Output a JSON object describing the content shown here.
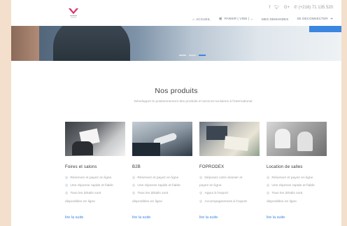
{
  "header": {
    "phone": "(+216) 71 135 520",
    "social": [
      "f",
      "twitter",
      "G+"
    ],
    "nav": [
      {
        "label": "ACCUEIL",
        "icon": "home-icon"
      },
      {
        "label": "PANIER ( VIDE )",
        "icon": "cart-icon"
      },
      {
        "label": "MES DEMANDES",
        "icon": ""
      },
      {
        "label": "SE DECONNECTER ",
        "icon": ""
      }
    ]
  },
  "section": {
    "title": "Nos produits",
    "subtitle": "Développer le positionnement des produits et services tunisiens à l'international"
  },
  "cards": [
    {
      "title": "Foires et salons",
      "items": [
        "Réservez et payez en ligne",
        "Une réponse rapide et fiable",
        "Tous les détails sont",
        "disponibles en ligne"
      ],
      "more": "lire la suite"
    },
    {
      "title": "B2B",
      "items": [
        "Réservez et payez en ligne",
        "Une réponse rapide et fiable",
        "Tous les détails sont",
        "disponibles en ligne"
      ],
      "more": "lire la suite"
    },
    {
      "title": "FOPRODEX",
      "items": [
        "Déposez votre dossier et",
        "payez en ligne",
        "Appui à l'export",
        "Accompagnement à l'export"
      ],
      "more": "lire la suite"
    },
    {
      "title": "Location de salles",
      "items": [
        "Réservez et payez en ligne",
        "Une réponse rapide et fiable",
        "Tous les détails sont",
        "disponibles en ligne"
      ],
      "more": "lire la suite"
    }
  ],
  "colors": {
    "accent": "#3a86e0",
    "background_frame": "#f3dfcb"
  }
}
